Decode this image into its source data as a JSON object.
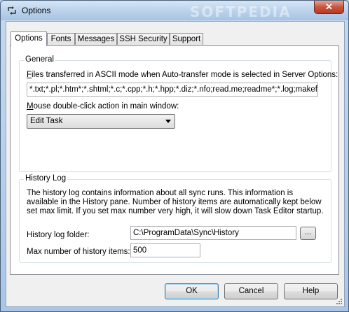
{
  "window": {
    "title": "Options",
    "close_glyph": "✕",
    "watermark": "SOFTPEDIA"
  },
  "tabs": [
    {
      "label": "Options",
      "active": true
    },
    {
      "label": "Fonts",
      "active": false
    },
    {
      "label": "Messages",
      "active": false
    },
    {
      "label": "SSH Security",
      "active": false
    },
    {
      "label": "Support",
      "active": false
    }
  ],
  "general": {
    "title": "General",
    "ascii_label_hotkey": "F",
    "ascii_label_rest": "iles transferred in ASCII mode when Auto-transfer mode is selected in Server Options:",
    "ascii_value": "*.txt;*.pl;*.htm*;*.shtml;*.c;*.cpp;*.h;*.hpp;*.diz;*.nfo;read.me;readme*;*.log;makefile;*.ma",
    "dblclick_label_hotkey": "M",
    "dblclick_label_rest": "ouse double-click action in main window:",
    "dblclick_value": "Edit Task"
  },
  "history": {
    "title": "History Log",
    "description": "The history log contains information about all sync runs. This information is available in the History pane. Number of history items are automatically kept below set max limit. If you set max number very high, it will slow down Task Editor startup.",
    "folder_label": "History log folder:",
    "folder_value": "C:\\ProgramData\\Sync\\History",
    "browse_label": "...",
    "max_label": "Max number of history items:",
    "max_value": "500"
  },
  "buttons": {
    "ok": "OK",
    "cancel": "Cancel",
    "help": "Help"
  },
  "icons": {
    "app": "sync-arrows-icon",
    "close": "close-icon",
    "dropdown": "chevron-down-icon",
    "grip": "resize-grip-icon"
  }
}
